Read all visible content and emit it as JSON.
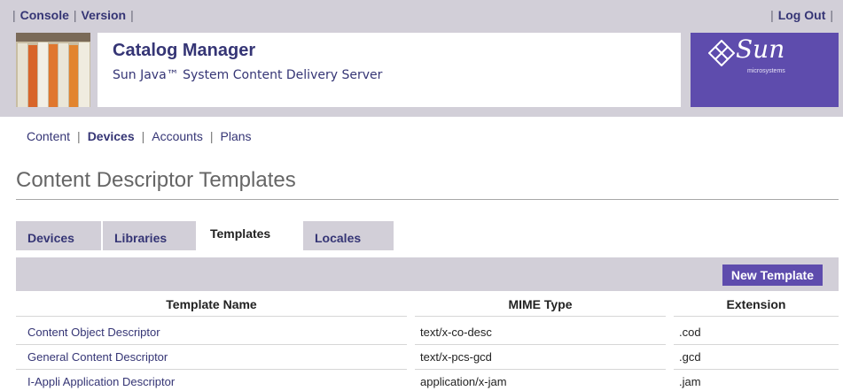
{
  "utility": {
    "console": "Console",
    "version": "Version",
    "logout": "Log Out",
    "sep": "|"
  },
  "banner": {
    "title": "Catalog Manager",
    "subtitle": "Sun Java™ System Content Delivery Server",
    "logo_word": "Sun",
    "logo_micro": "microsystems",
    "logo_color": "#5e4cad"
  },
  "nav": {
    "items": [
      "Content",
      "Devices",
      "Accounts",
      "Plans"
    ],
    "active": "Devices",
    "sep": "|"
  },
  "page": {
    "title": "Content Descriptor Templates"
  },
  "tabs": {
    "items": [
      "Devices",
      "Libraries",
      "Templates",
      "Locales"
    ],
    "active": "Templates"
  },
  "toolbar": {
    "new_template": "New Template"
  },
  "table": {
    "headers": [
      "Template Name",
      "MIME Type",
      "Extension"
    ],
    "rows": [
      {
        "name": "Content Object Descriptor",
        "mime": "text/x-co-desc",
        "ext": ".cod"
      },
      {
        "name": "General Content Descriptor",
        "mime": "text/x-pcs-gcd",
        "ext": ".gcd"
      },
      {
        "name": "I-Appli Application Descriptor",
        "mime": "application/x-jam",
        "ext": ".jam"
      }
    ]
  },
  "colors": {
    "accent": "#5e4cad",
    "link": "#353575",
    "masthead": "#d2cfd8"
  }
}
